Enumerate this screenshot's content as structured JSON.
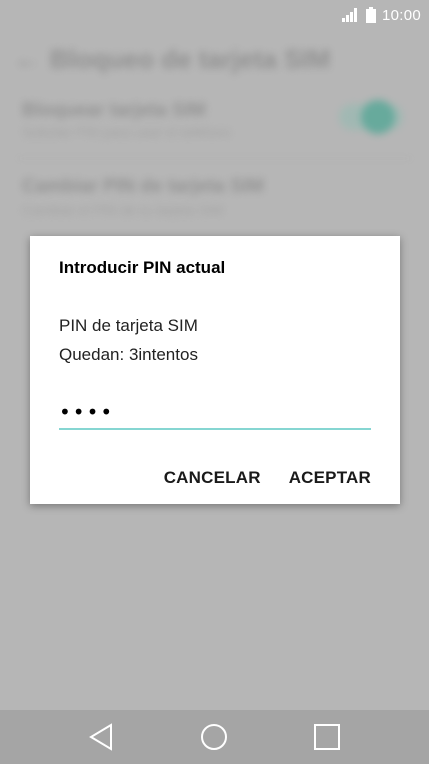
{
  "status_bar": {
    "time": "10:00",
    "signal_icon": "signal-icon",
    "battery_icon": "battery-icon"
  },
  "background": {
    "header_title": "Bloqueo de tarjeta SIM",
    "row1_title": "Bloquear tarjeta SIM",
    "row1_subtitle": "Solicitar PIN para usar el teléfono",
    "row2_title": "Cambiar PIN de tarjeta SIM",
    "row2_subtitle": "Cambiar el PIN de tu tarjeta SIM"
  },
  "dialog": {
    "title": "Introducir PIN actual",
    "message_line1": "PIN de tarjeta SIM",
    "message_line2": "Quedan: 3intentos",
    "pin_value": "••••",
    "cancel_label": "CANCELAR",
    "ok_label": "ACEPTAR",
    "accent_color": "#86d6d2"
  },
  "nav_bar": {
    "back_icon": "back-triangle-icon",
    "home_icon": "home-circle-icon",
    "recents_icon": "recents-square-icon"
  }
}
